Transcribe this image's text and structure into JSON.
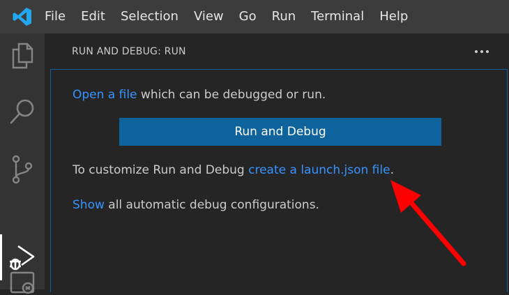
{
  "menubar": {
    "items": [
      "File",
      "Edit",
      "Selection",
      "View",
      "Go",
      "Run",
      "Terminal",
      "Help"
    ]
  },
  "activitybar": {
    "icons": [
      "explorer-icon",
      "search-icon",
      "source-control-icon",
      "run-debug-icon",
      "remote-explorer-icon"
    ],
    "active": "run-debug-icon"
  },
  "sidebar": {
    "title": "RUN AND DEBUG: RUN",
    "open_file_link": "Open a file",
    "open_file_rest": " which can be debugged or run.",
    "run_button_label": "Run and Debug",
    "customize_text": "To customize Run and Debug ",
    "launch_link": "create a launch.json file",
    "customize_end": ".",
    "show_link": "Show",
    "show_rest": " all automatic debug configurations."
  },
  "colors": {
    "accent": "#0e639c",
    "link": "#3794ff",
    "annotation_arrow": "#ff0000"
  }
}
